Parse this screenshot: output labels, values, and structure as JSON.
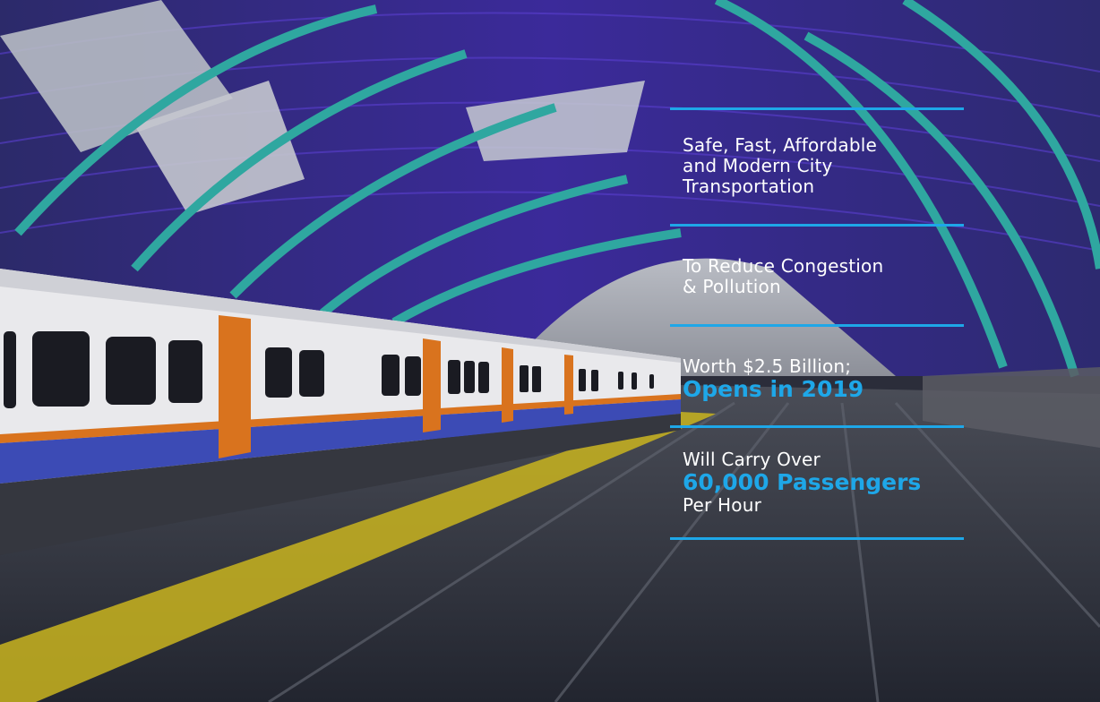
{
  "colors": {
    "accent": "#1ea7e8",
    "text": "#ffffff",
    "roof": "#3a2a8c",
    "arch": "#2fa7a0",
    "train_body": "#e9e9ec",
    "train_door": "#d9731e",
    "train_stripe": "#3c4bb5",
    "platform": "#2a2d38",
    "tactile": "#c9b41e"
  },
  "image": {
    "subject": "illustration-train-at-platform-under-arched-canopy"
  },
  "panel": {
    "block1": {
      "lines": [
        "Safe, Fast, Affordable",
        "and Modern City",
        "Transportation"
      ]
    },
    "block2": {
      "lines": [
        "To Reduce Congestion",
        "& Pollution"
      ]
    },
    "block3": {
      "line": "Worth $2.5 Billion;",
      "highlight": "Opens in 2019"
    },
    "block4": {
      "line": "Will Carry Over",
      "highlight": "60,000 Passengers",
      "suffix": "Per Hour"
    }
  }
}
